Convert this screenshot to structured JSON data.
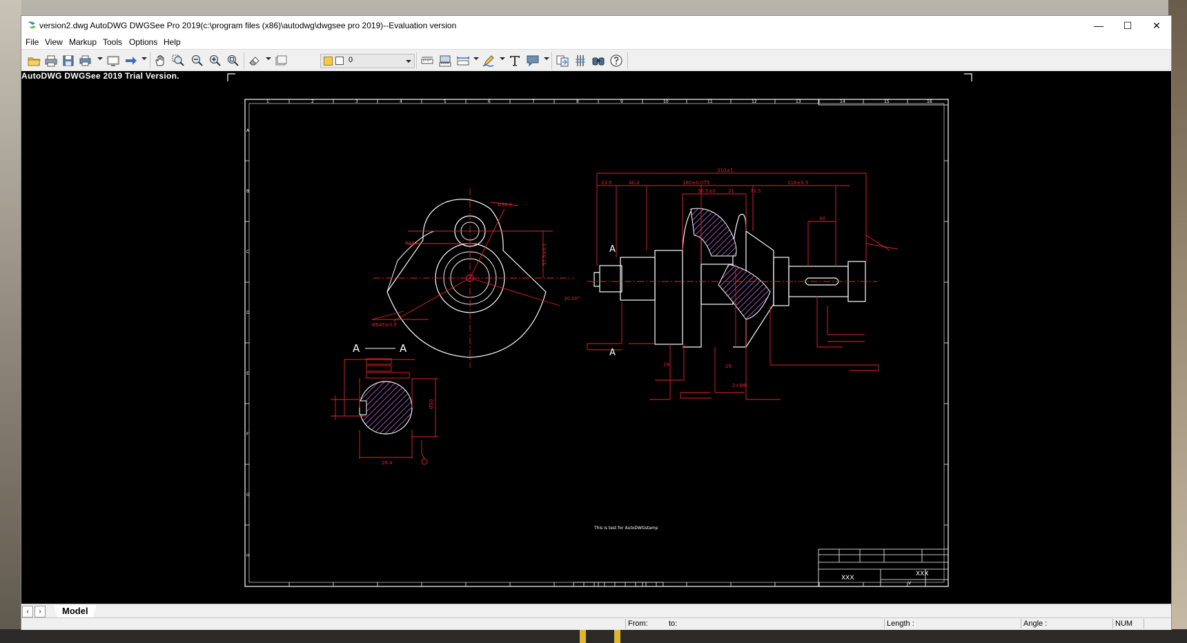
{
  "window": {
    "title": "version2.dwg AutoDWG DWGSee Pro 2019(c:\\program files (x86)\\autodwg\\dwgsee pro 2019)--Evaluation version",
    "controls": {
      "minimize": "—",
      "maximize": "☐",
      "close": "✕"
    }
  },
  "menu": {
    "items": [
      "File",
      "View",
      "Markup",
      "Tools",
      "Options",
      "Help"
    ]
  },
  "toolbar": {
    "layer_value": "0",
    "icons": [
      "open-folder-icon",
      "print-icon",
      "save-icon",
      "batch-print-icon",
      "screen-icon",
      "forward-arrow-icon",
      "pan-hand-icon",
      "zoom-window-icon",
      "zoom-out-icon",
      "zoom-in-icon",
      "zoom-extents-icon",
      "eraser-icon",
      "frame-icon",
      "layer-icon",
      "measure-distance-icon",
      "measure-area-icon",
      "dimension-icon",
      "markup-pen-icon",
      "text-icon",
      "callout-icon",
      "compare-icon",
      "split-icon",
      "find-icon",
      "help-icon"
    ]
  },
  "canvas": {
    "background": "#000000",
    "trial_text": "AutoDWG DWGSee 2019 Trial Version.",
    "drawing": {
      "section_label_left": "A",
      "section_label_right": "A",
      "note_text": "This is test for AutoDWGstamp",
      "title_block_text_1": "XXX",
      "title_block_text_2": "XXX",
      "title_block_text_3": "V",
      "zone_numbers": [
        "1",
        "2",
        "3",
        "4",
        "5",
        "6",
        "7",
        "8",
        "9",
        "10",
        "11",
        "12",
        "13",
        "14",
        "15",
        "16"
      ],
      "zone_letters": [
        "A",
        "B",
        "C",
        "D",
        "E",
        "F",
        "G",
        "H"
      ],
      "dim_labels": [
        "Ø38.5",
        "R117",
        "Ø645±0.5",
        "30.00°",
        "57.5±0.1",
        "310±1",
        "23.5",
        "40.2",
        "180±0.075",
        "116±0.5",
        "36.5±0",
        "21",
        "71.5",
        "40",
        "29",
        "29",
        "2×Ø6",
        "Ø50",
        "26.4"
      ],
      "colors": {
        "geometry": "#ffffff",
        "dimensions": "#e8242a",
        "hatch": "#9b59b6"
      }
    }
  },
  "tabs": {
    "prev": "‹",
    "next": "›",
    "active": "Model"
  },
  "status": {
    "from": "From:",
    "to": "to:",
    "length": "Length :",
    "angle": "Angle :",
    "num": "NUM"
  }
}
